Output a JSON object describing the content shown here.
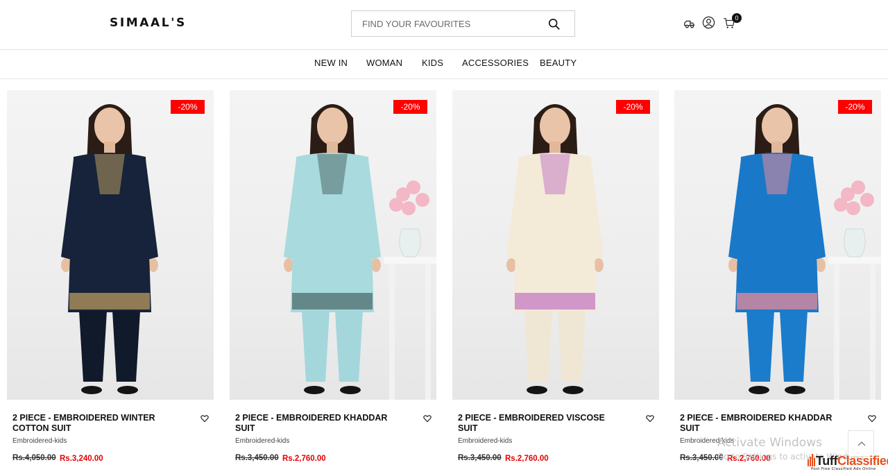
{
  "header": {
    "logo": "SIMAAL'S",
    "search_placeholder": "FIND YOUR FAVOURITES",
    "cart_count": "0"
  },
  "nav": [
    "NEW IN",
    "WOMAN",
    "KIDS",
    "ACCESSORIES",
    "BEAUTY"
  ],
  "products": [
    {
      "badge": "-20%",
      "name": "2 PIECE - EMBROIDERED WINTER COTTON SUIT",
      "category": "Embroidered-kids",
      "old_price": "Rs.4,050.00",
      "price": "Rs.3,240.00",
      "dress_color": "#17233a",
      "pants_color": "#111a2b",
      "accent": "#b89a5e",
      "vase": false
    },
    {
      "badge": "-20%",
      "name": "2 PIECE - EMBROIDERED KHADDAR SUIT",
      "category": "Embroidered-kids",
      "old_price": "Rs.3,450.00",
      "price": "Rs.2,760.00",
      "dress_color": "#a8dade",
      "pants_color": "#a3d7dc",
      "accent": "#4e6c6c",
      "vase": true
    },
    {
      "badge": "-20%",
      "name": "2 PIECE - EMBROIDERED VISCOSE SUIT",
      "category": "Embroidered-kids",
      "old_price": "Rs.3,450.00",
      "price": "Rs.2,760.00",
      "dress_color": "#f3ead8",
      "pants_color": "#efe6d4",
      "accent": "#c57bc4",
      "vase": false
    },
    {
      "badge": "-20%",
      "name": "2 PIECE - EMBROIDERED KHADDAR SUIT",
      "category": "Embroidered-kids",
      "old_price": "Rs.3,450.00",
      "price": "Rs.2,760.00",
      "dress_color": "#1a78c8",
      "pants_color": "#1b7ccc",
      "accent": "#e88a9a",
      "vase": true
    }
  ],
  "watermark": {
    "title": "Activate Windows",
    "subtitle": "Go to Settings to activate Windows."
  },
  "tuffclassified": {
    "name": "TuffClassified",
    "tagline": "Post Free Classified Ads Online"
  }
}
